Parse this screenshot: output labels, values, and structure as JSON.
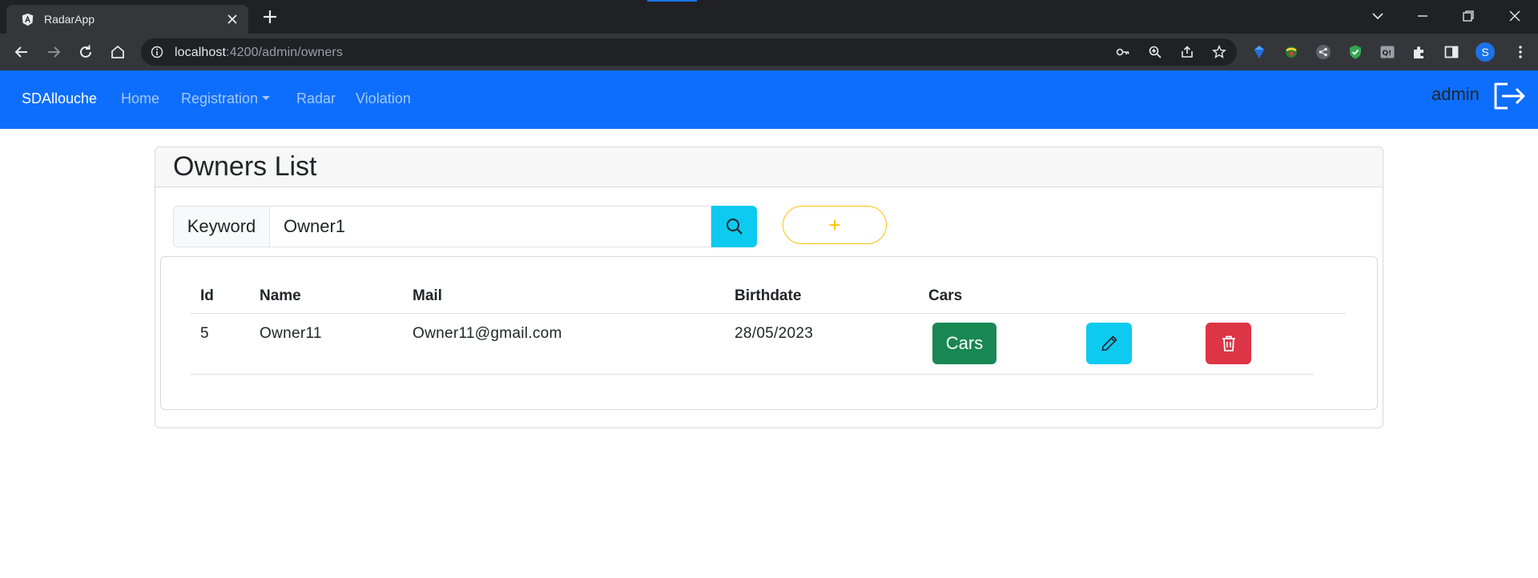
{
  "browser": {
    "tab_title": "RadarApp",
    "url_host": "localhost",
    "url_path": ":4200/admin/owners",
    "profile_initial": "S"
  },
  "navbar": {
    "brand": "SDAllouche",
    "links": [
      "Home",
      "Registration",
      "Radar",
      "Violation"
    ],
    "user": "admin"
  },
  "page": {
    "title": "Owners List",
    "search_label": "Keyword",
    "search_value": "Owner1",
    "add_label": "+"
  },
  "table": {
    "headers": [
      "Id",
      "Name",
      "Mail",
      "Birthdate",
      "Cars"
    ],
    "rows": [
      {
        "id": "5",
        "name": "Owner11",
        "mail": "Owner11@gmail.com",
        "birthdate": "28/05/2023",
        "cars_label": "Cars"
      }
    ]
  },
  "colors": {
    "navbar": "#0d6efd",
    "cars_button": "#198754",
    "edit_button": "#0dcaf0",
    "delete_button": "#dc3545",
    "add_button": "#ffc107"
  }
}
